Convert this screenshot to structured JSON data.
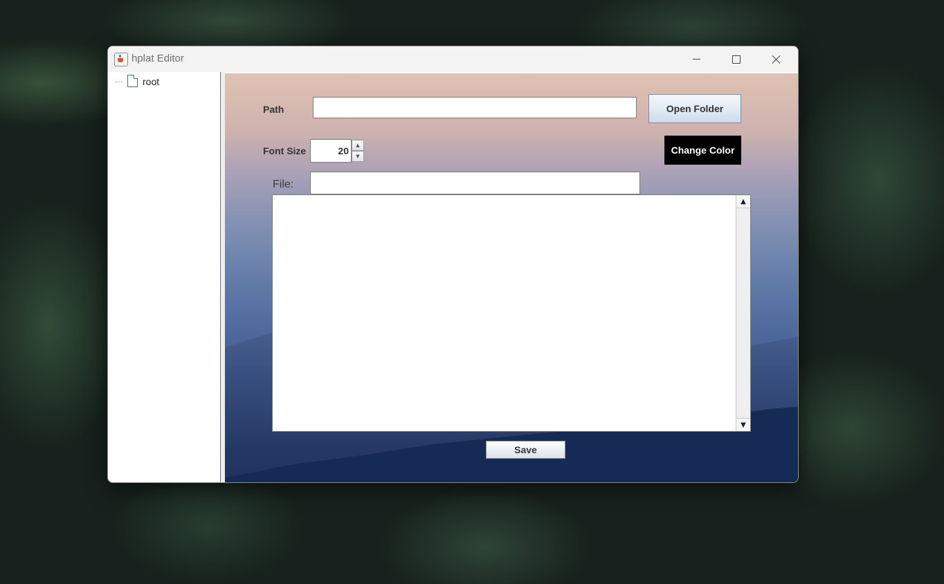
{
  "window": {
    "title": "hplat Editor",
    "controls": {
      "minimize": "minimize-icon",
      "maximize": "maximize-icon",
      "close": "close-icon"
    }
  },
  "tree": {
    "root_label": "root",
    "root_icon": "file-icon"
  },
  "form": {
    "path_label": "Path",
    "path_value": "",
    "open_folder_label": "Open Folder",
    "font_size_label": "Font Size",
    "font_size_value": "20",
    "change_color_label": "Change Color",
    "file_label": "File:",
    "file_value": "",
    "editor_text": "",
    "save_label": "Save"
  },
  "colors": {
    "change_color_button_bg": "#000000",
    "change_color_button_text": "#ffffff"
  }
}
